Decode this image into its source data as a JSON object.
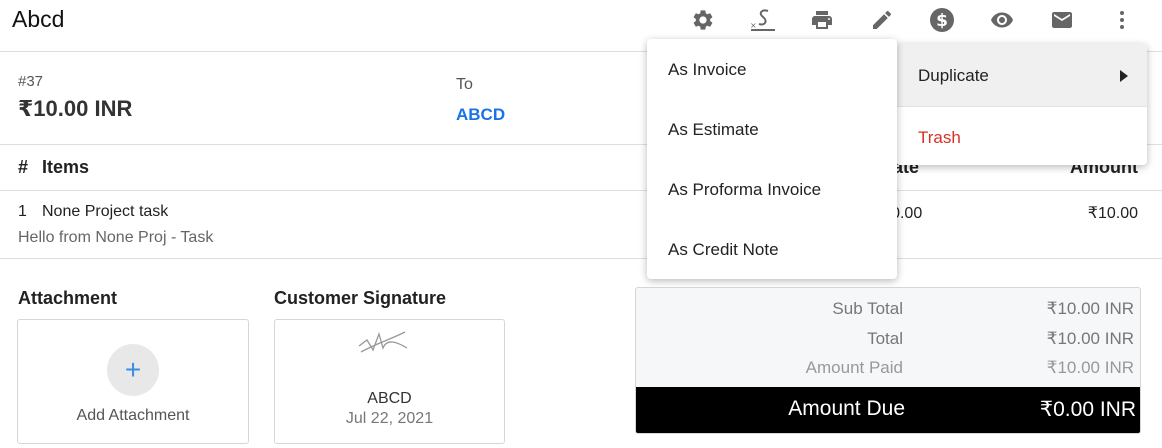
{
  "header": {
    "title": "Abcd",
    "icons": [
      "gear-icon",
      "signature-icon",
      "print-icon",
      "edit-icon",
      "dollar-icon",
      "eye-icon",
      "mail-icon",
      "more-vert-icon"
    ]
  },
  "invoice": {
    "number": "#37",
    "amount": "₹10.00 INR",
    "to_label": "To",
    "client": "ABCD"
  },
  "table": {
    "col_hash": "#",
    "col_items": "Items",
    "col_rate": "Rate",
    "col_amount": "Amount",
    "rows": [
      {
        "index": "1",
        "name": "None Project task",
        "description": "Hello from None Proj - Task",
        "rate": "₹10.00",
        "amount": "₹10.00"
      }
    ]
  },
  "attachment": {
    "title": "Attachment",
    "add_label": "Add Attachment",
    "plus": "+"
  },
  "signature": {
    "title": "Customer Signature",
    "name": "ABCD",
    "date": "Jul 22, 2021"
  },
  "totals": {
    "sub_total_label": "Sub Total",
    "sub_total_value": "₹10.00 INR",
    "total_label": "Total",
    "total_value": "₹10.00 INR",
    "amount_paid_label": "Amount Paid",
    "amount_paid_value": "₹10.00 INR",
    "amount_due_label": "Amount Due",
    "amount_due_value": "₹0.00 INR"
  },
  "more_menu": {
    "duplicate": "Duplicate",
    "trash": "Trash"
  },
  "duplicate_menu": {
    "items": [
      "As Invoice",
      "As Estimate",
      "As Proforma Invoice",
      "As Credit Note"
    ]
  },
  "colors": {
    "accent": "#1a73e8",
    "danger": "#d93025",
    "icon": "#666666",
    "due_bg": "#000000"
  }
}
